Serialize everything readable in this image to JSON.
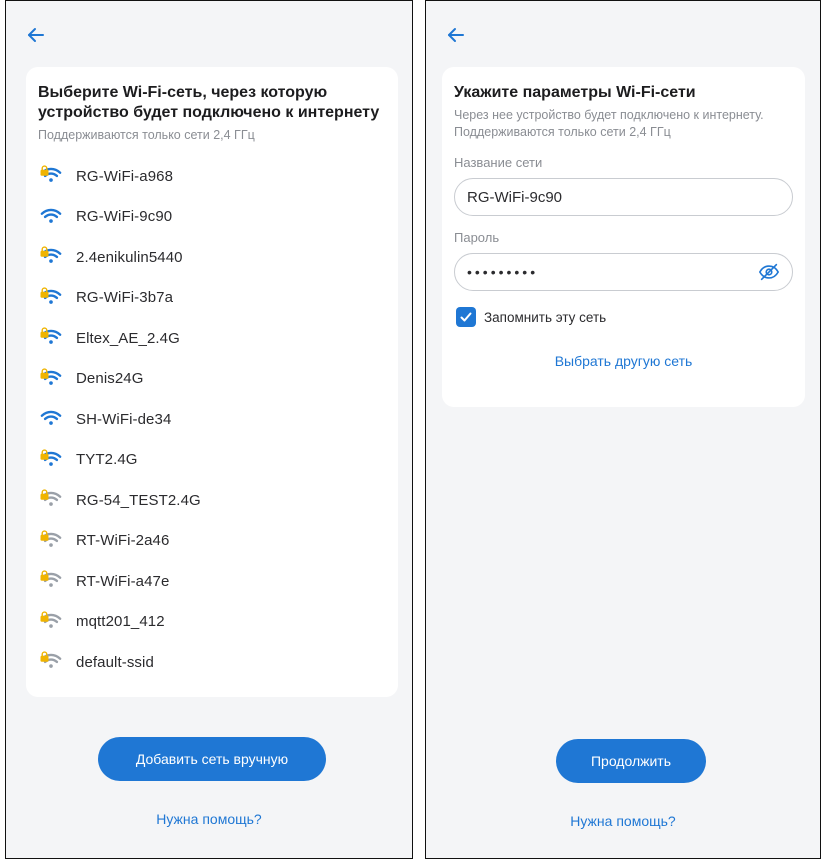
{
  "left": {
    "title": "Выберите Wi-Fi-сеть, через которую устройство будет подключено к интернету",
    "subtitle": "Поддерживаются только сети 2,4 ГГц",
    "networks": [
      {
        "name": "RG-WiFi-a968",
        "strength": "strong",
        "locked": true
      },
      {
        "name": "RG-WiFi-9c90",
        "strength": "strong",
        "locked": false
      },
      {
        "name": "2.4enikulin5440",
        "strength": "strong",
        "locked": true
      },
      {
        "name": "RG-WiFi-3b7a",
        "strength": "strong",
        "locked": true
      },
      {
        "name": "Eltex_AE_2.4G",
        "strength": "strong",
        "locked": true
      },
      {
        "name": "Denis24G",
        "strength": "strong",
        "locked": true
      },
      {
        "name": "SH-WiFi-de34",
        "strength": "strong",
        "locked": false
      },
      {
        "name": "TYT2.4G",
        "strength": "strong",
        "locked": true
      },
      {
        "name": "RG-54_TEST2.4G",
        "strength": "weak",
        "locked": true
      },
      {
        "name": "RT-WiFi-2a46",
        "strength": "weak",
        "locked": true
      },
      {
        "name": "RT-WiFi-a47e",
        "strength": "weak",
        "locked": true
      },
      {
        "name": "mqtt201_412",
        "strength": "weak",
        "locked": true
      },
      {
        "name": "default-ssid",
        "strength": "weak",
        "locked": true
      }
    ],
    "add_button": "Добавить сеть вручную",
    "help_link": "Нужна помощь?"
  },
  "right": {
    "title": "Укажите параметры Wi-Fi-сети",
    "subtitle": "Через нее устройство будет подключено к интернету. Поддерживаются только сети 2,4 ГГц",
    "network_label": "Название сети",
    "network_value": "RG-WiFi-9c90",
    "password_label": "Пароль",
    "password_masked": "•••••••••",
    "remember_label": "Запомнить эту сеть",
    "remember_checked": true,
    "other_network_link": "Выбрать другую сеть",
    "continue_button": "Продолжить",
    "help_link": "Нужна помощь?"
  },
  "colors": {
    "accent": "#1f77d4",
    "wifi_strong": "#1f77d4",
    "wifi_weak": "#9aa0a8",
    "lock": "#f0b400"
  }
}
